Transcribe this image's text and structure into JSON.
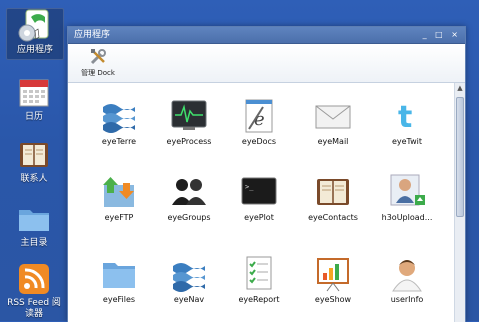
{
  "desktop": {
    "icons": [
      {
        "label": "应用程序"
      },
      {
        "label": "日历"
      },
      {
        "label": "联系人"
      },
      {
        "label": "主目录"
      },
      {
        "label": "RSS Feed 阅读器"
      }
    ]
  },
  "window": {
    "title": "应用程序",
    "controls": "_ □ ×",
    "toolbar": {
      "manage_dock": "管理 Dock"
    },
    "apps": [
      {
        "name": "eyeTerre"
      },
      {
        "name": "eyeProcess"
      },
      {
        "name": "eyeDocs"
      },
      {
        "name": "eyeMail"
      },
      {
        "name": "eyeTwit"
      },
      {
        "name": "eyeFTP"
      },
      {
        "name": "eyeGroups"
      },
      {
        "name": "eyePlot"
      },
      {
        "name": "eyeContacts"
      },
      {
        "name": "h3oUpload..."
      },
      {
        "name": "eyeFiles"
      },
      {
        "name": "eyeNav"
      },
      {
        "name": "eyeReport"
      },
      {
        "name": "eyeShow"
      },
      {
        "name": "userInfo"
      }
    ]
  },
  "colors": {
    "desktop": "#2b56a4",
    "titlebar": "#4b6fab",
    "accent": "#3cab4b"
  }
}
